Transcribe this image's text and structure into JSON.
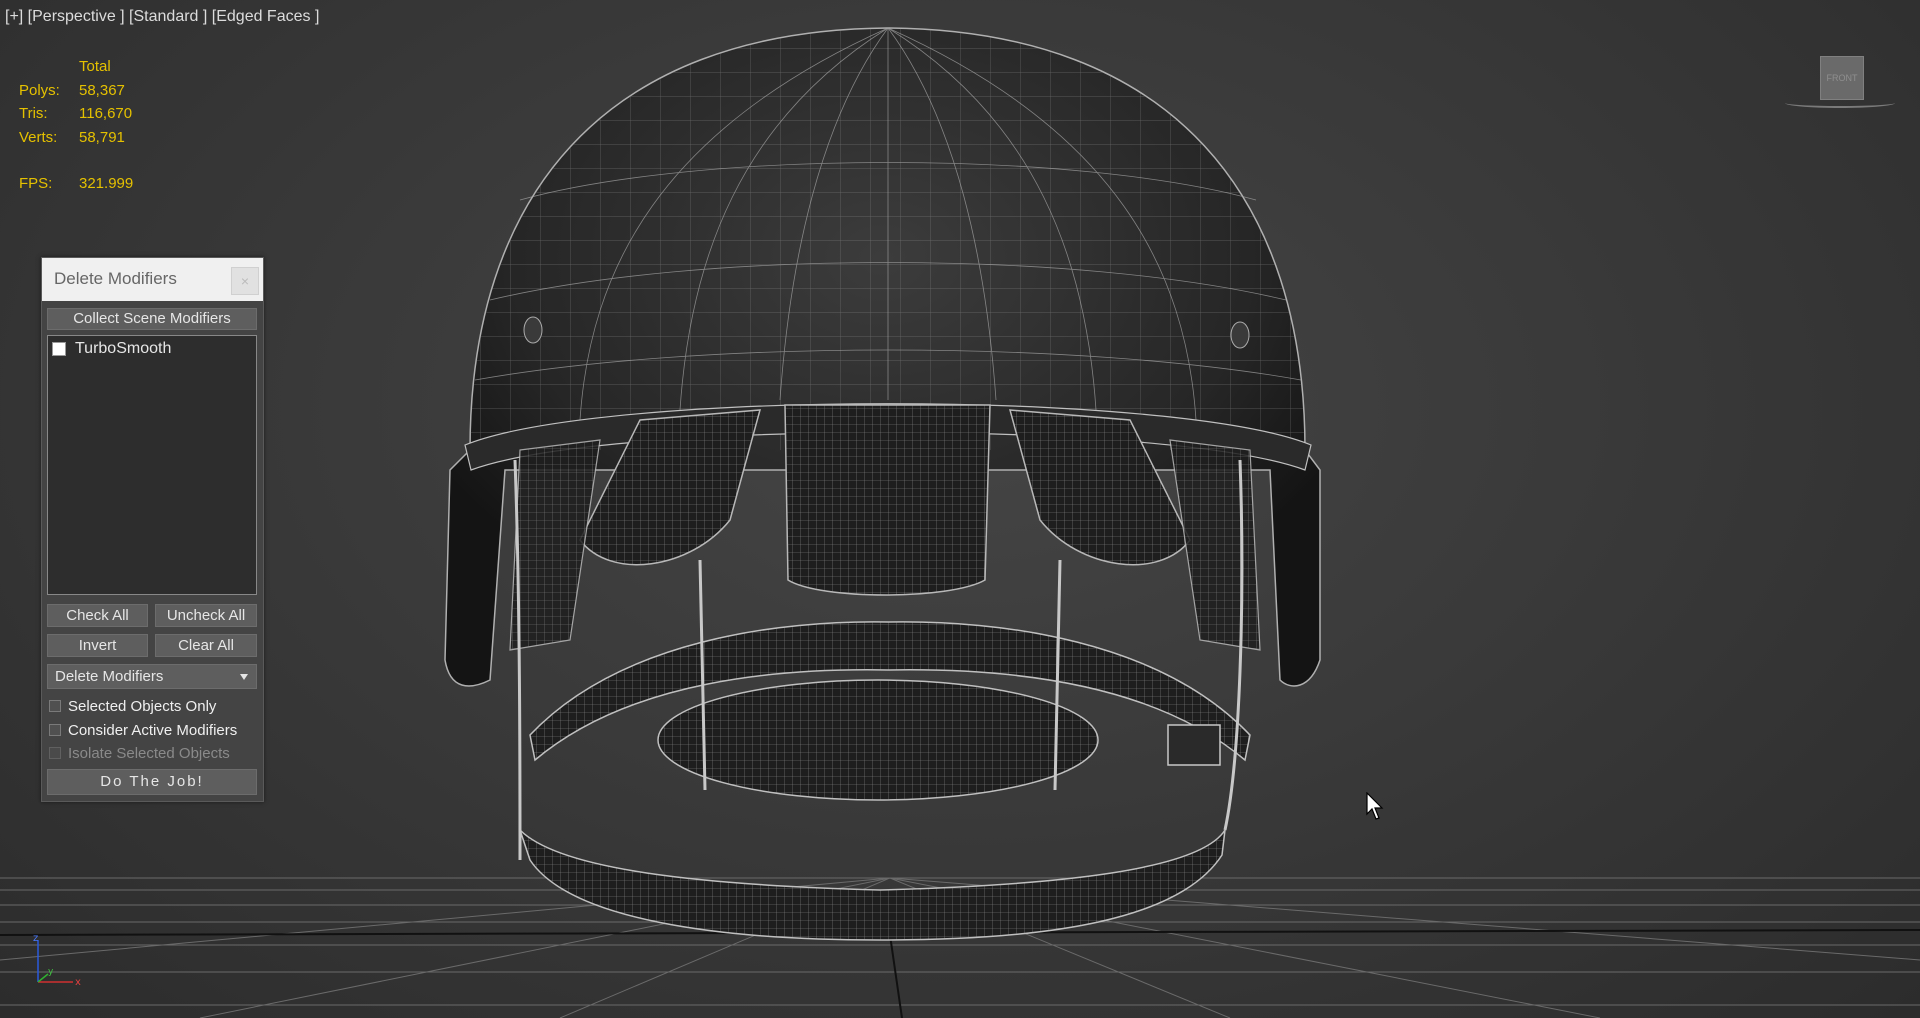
{
  "viewport": {
    "label": "[+] [Perspective ] [Standard ] [Edged Faces ]",
    "viewcube_label": "FRONT"
  },
  "stats": {
    "header": "Total",
    "rows": [
      {
        "label": "Polys:",
        "value": "58,367"
      },
      {
        "label": "Tris:",
        "value": "116,670"
      },
      {
        "label": "Verts:",
        "value": "58,791"
      }
    ],
    "fps": {
      "label": "FPS:",
      "value": "321.999"
    },
    "color": "#e5c100"
  },
  "dialog": {
    "title": "Delete Modifiers",
    "close_label": "×",
    "collect_button": "Collect Scene Modifiers",
    "modifiers": [
      {
        "label": "TurboSmooth",
        "checked": false
      }
    ],
    "check_all": "Check All",
    "uncheck_all": "Uncheck All",
    "invert": "Invert",
    "clear_all": "Clear All",
    "action_select": "Delete Modifiers",
    "options": {
      "selected_only": "Selected Objects Only",
      "consider_active": "Consider Active Modifiers",
      "isolate_selected": "Isolate Selected Objects"
    },
    "do_job": "Do The Job!"
  },
  "axis": {
    "x": "x",
    "y": "y",
    "z": "z"
  },
  "icons": {
    "close": "close-icon",
    "dropdown": "chevron-down-icon",
    "cursor": "mouse-cursor-icon",
    "axis": "axis-tripod-icon",
    "viewcube": "viewcube-icon"
  }
}
